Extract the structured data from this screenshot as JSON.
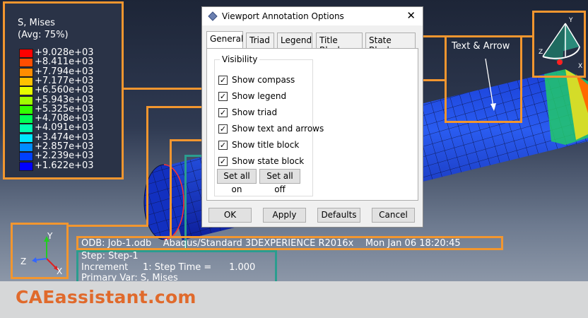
{
  "legend": {
    "title_line1": "S, Mises",
    "title_line2": "(Avg: 75%)",
    "items": [
      {
        "color": "#ff0000",
        "value": "+9.028e+03"
      },
      {
        "color": "#ff4d00",
        "value": "+8.411e+03"
      },
      {
        "color": "#ff8c00",
        "value": "+7.794e+03"
      },
      {
        "color": "#ffc200",
        "value": "+7.177e+03"
      },
      {
        "color": "#e6ff00",
        "value": "+6.560e+03"
      },
      {
        "color": "#a0ff00",
        "value": "+5.943e+03"
      },
      {
        "color": "#33ff00",
        "value": "+5.325e+03"
      },
      {
        "color": "#00ff55",
        "value": "+4.708e+03"
      },
      {
        "color": "#00ffb0",
        "value": "+4.091e+03"
      },
      {
        "color": "#00e6ff",
        "value": "+3.474e+03"
      },
      {
        "color": "#008cff",
        "value": "+2.857e+03"
      },
      {
        "color": "#0040ff",
        "value": "+2.239e+03"
      },
      {
        "color": "#0000ff",
        "value": "+1.622e+03"
      }
    ]
  },
  "dialog": {
    "title": "Viewport Annotation Options",
    "tabs": [
      "General",
      "Triad",
      "Legend",
      "Title Block",
      "State Block"
    ],
    "group_label": "Visibility",
    "checkboxes": [
      {
        "label": "Show compass",
        "checked": true
      },
      {
        "label": "Show legend",
        "checked": true
      },
      {
        "label": "Show triad",
        "checked": true
      },
      {
        "label": "Show text and arrows",
        "checked": true
      },
      {
        "label": "Show title block",
        "checked": true
      },
      {
        "label": "Show state block",
        "checked": true
      }
    ],
    "set_all_on": "Set all on",
    "set_all_off": "Set all off",
    "ok": "OK",
    "apply": "Apply",
    "defaults": "Defaults",
    "cancel": "Cancel"
  },
  "text_arrow_label": "Text & Arrow",
  "triad": {
    "x": "X",
    "y": "Y",
    "z": "Z"
  },
  "compass": {
    "x": "X",
    "y": "Y",
    "z": "Z"
  },
  "title_block": "ODB: Job-1.odb    Abaqus/Standard 3DEXPERIENCE R2016x    Mon Jan 06 18:20:45",
  "state_block": {
    "line1": "Step: Step-1",
    "line2": "Increment     1: Step Time =      1.000",
    "line3": "Primary Var: S, Mises"
  },
  "brand": "CAEassistant.com",
  "colors": {
    "accent_orange": "#f2962f",
    "accent_teal": "#2a9d8f",
    "brand": "#e06a2c"
  }
}
